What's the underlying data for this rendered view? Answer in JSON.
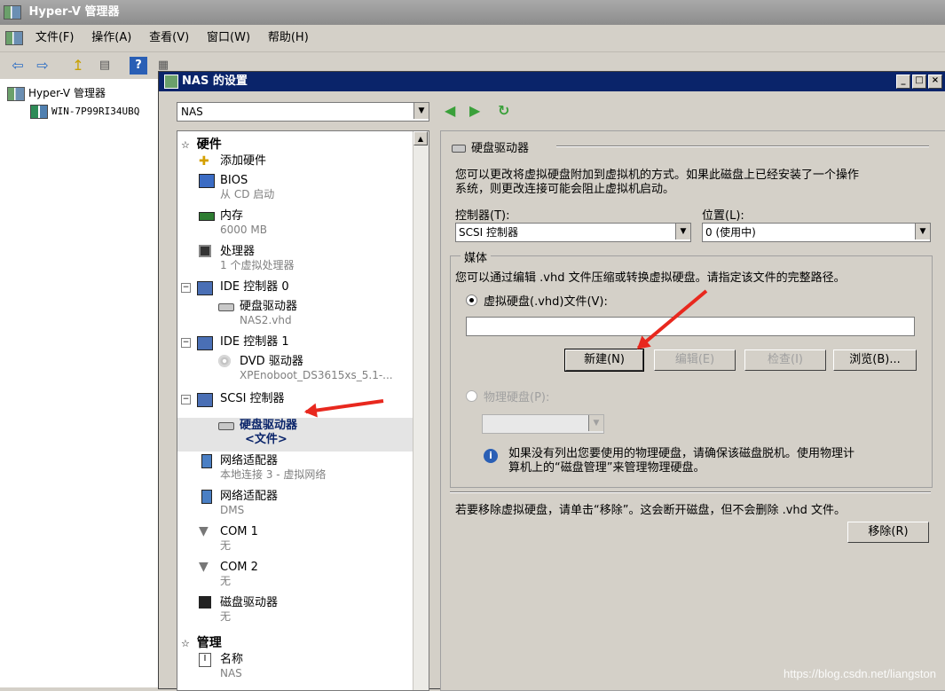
{
  "app": {
    "title": "Hyper-V 管理器",
    "menu": [
      "文件(F)",
      "操作(A)",
      "查看(V)",
      "窗口(W)",
      "帮助(H)"
    ],
    "tree": {
      "root": "Hyper-V 管理器",
      "server": "WIN-7P99RI34UBQ"
    }
  },
  "dialog": {
    "title": "NAS 的设置",
    "vm_select": "NAS",
    "hardware": {
      "section_hardware": "硬件",
      "add_hardware": "添加硬件",
      "bios": {
        "label": "BIOS",
        "sub": "从 CD 启动"
      },
      "memory": {
        "label": "内存",
        "sub": "6000 MB"
      },
      "processor": {
        "label": "处理器",
        "sub": "1 个虚拟处理器"
      },
      "ide0": {
        "label": "IDE 控制器 0",
        "disk_label": "硬盘驱动器",
        "disk_sub": "NAS2.vhd"
      },
      "ide1": {
        "label": "IDE 控制器 1",
        "dvd_label": "DVD 驱动器",
        "dvd_sub": "XPEnoboot_DS3615xs_5.1-..."
      },
      "scsi": {
        "label": "SCSI 控制器",
        "disk_label": "硬盘驱动器",
        "disk_sub": "<文件>"
      },
      "net1": {
        "label": "网络适配器",
        "sub": "本地连接 3 - 虚拟网络"
      },
      "net2": {
        "label": "网络适配器",
        "sub": "DMS"
      },
      "com1": {
        "label": "COM 1",
        "sub": "无"
      },
      "com2": {
        "label": "COM 2",
        "sub": "无"
      },
      "floppy": {
        "label": "磁盘驱动器",
        "sub": "无"
      },
      "section_manage": "管理",
      "name": {
        "label": "名称",
        "sub": "NAS"
      }
    },
    "settings": {
      "heading": "硬盘驱动器",
      "desc": [
        "您可以更改将虚拟硬盘附加到虚拟机的方式。如果此磁盘上已经安装了一个操作",
        "系统，则更改连接可能会阻止虚拟机启动。"
      ],
      "controller_label": "控制器(T):",
      "controller_value": "SCSI 控制器",
      "location_label": "位置(L):",
      "location_value": "0 (使用中)",
      "media_label": "媒体",
      "media_desc": "您可以通过编辑 .vhd 文件压缩或转换虚拟硬盘。请指定该文件的完整路径。",
      "vhd_radio": "虚拟硬盘(.vhd)文件(V):",
      "path_value": "",
      "btn_new": "新建(N)",
      "btn_edit": "编辑(E)",
      "btn_inspect": "检查(I)",
      "btn_browse": "浏览(B)...",
      "physical_radio": "物理硬盘(P):",
      "info": [
        "如果没有列出您要使用的物理硬盘，请确保该磁盘脱机。使用物理计",
        "算机上的“磁盘管理”来管理物理硬盘。"
      ],
      "remove_text": "若要移除虚拟硬盘，请单击“移除”。这会断开磁盘，但不会删除 .vhd 文件。",
      "btn_remove": "移除(R)"
    }
  },
  "watermark": "https://blog.csdn.net/liangston"
}
